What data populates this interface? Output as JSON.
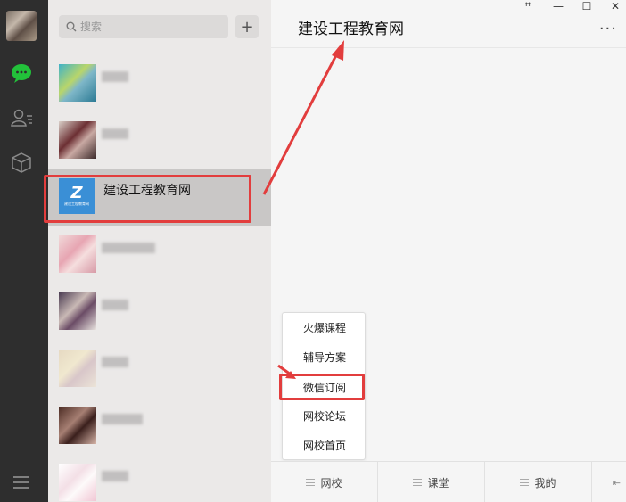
{
  "chat_title": "建设工程教育网",
  "search": {
    "placeholder": "搜索"
  },
  "add_label": "+",
  "selected_contact": {
    "name": "建设工程教育网",
    "logo_text": "建设工程教育网"
  },
  "window_controls": [
    "ꟸ",
    "—",
    "☐",
    "✕"
  ],
  "popup_menu": [
    "火爆课程",
    "辅导方案",
    "微信订阅",
    "网校论坛",
    "网校首页"
  ],
  "bottom_tabs": [
    "网校",
    "课堂",
    "我的"
  ],
  "accent_color": "#e23d3d",
  "icons": [
    "chat-icon",
    "contacts-icon",
    "box-icon",
    "menu-icon",
    "search-icon",
    "more-icon",
    "keyboard-icon"
  ]
}
